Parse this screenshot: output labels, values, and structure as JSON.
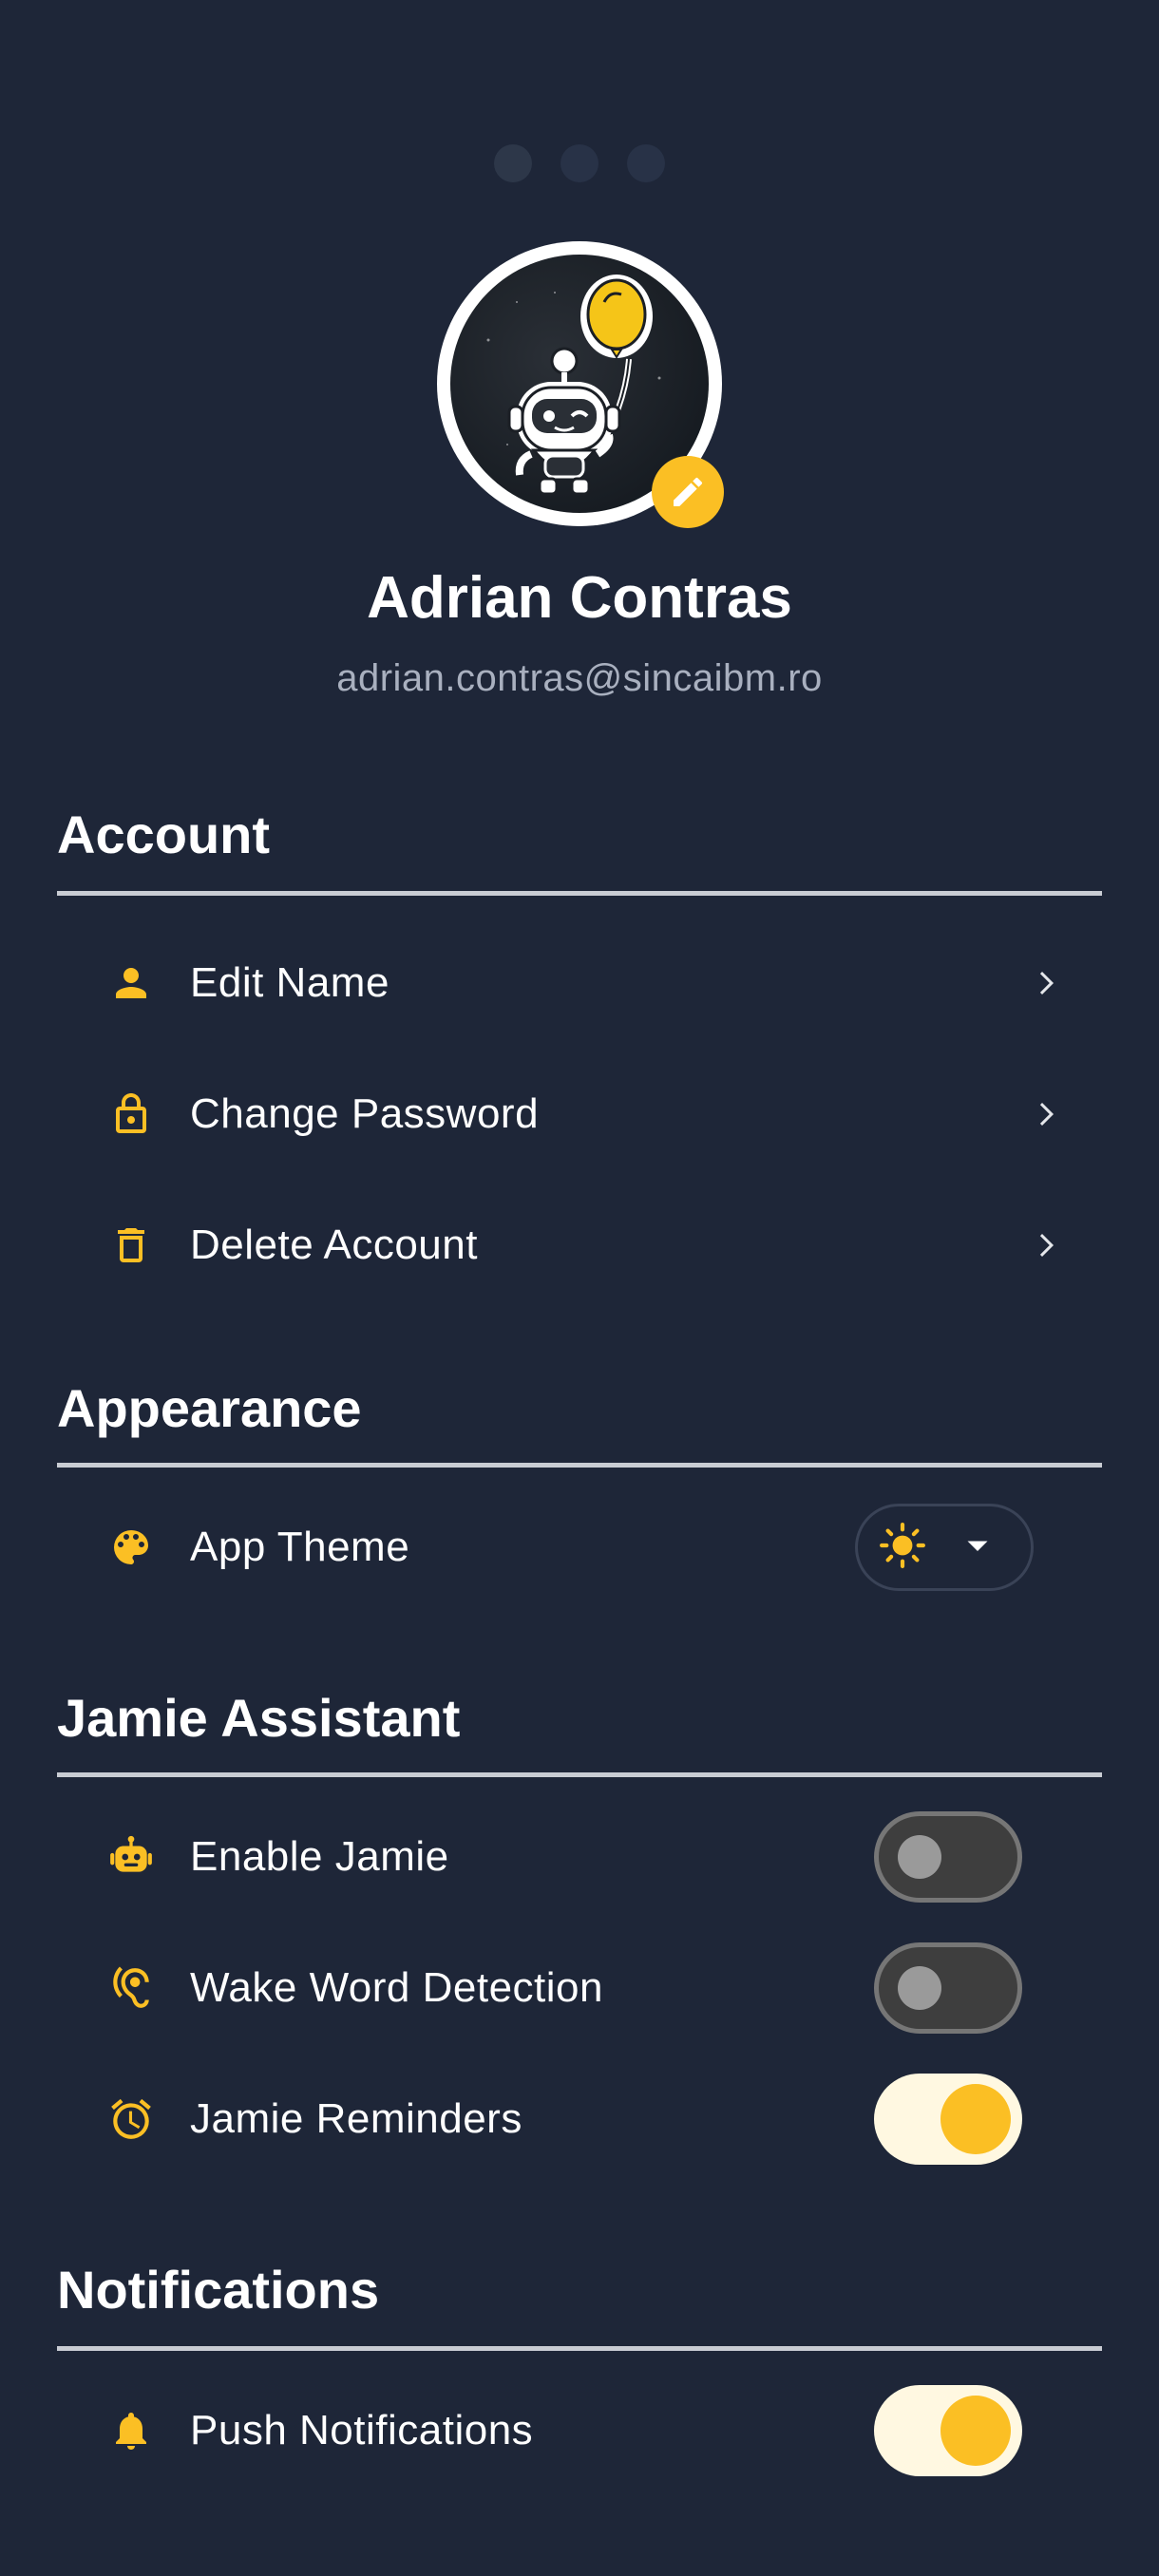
{
  "profile": {
    "name": "Adrian Contras",
    "email": "adrian.contras@sincaibm.ro"
  },
  "colors": {
    "background": "#1e2638",
    "accent": "#fbbf24",
    "text": "#ffffff",
    "muted": "#a9b0bf",
    "divider": "#c9ccd3"
  },
  "pager": {
    "count": 3,
    "active_index": 0
  },
  "sections": {
    "account": {
      "title": "Account",
      "items": [
        {
          "label": "Edit Name",
          "icon": "person-icon"
        },
        {
          "label": "Change Password",
          "icon": "lock-icon"
        },
        {
          "label": "Delete Account",
          "icon": "trash-icon"
        }
      ]
    },
    "appearance": {
      "title": "Appearance",
      "items": [
        {
          "label": "App Theme",
          "icon": "palette-icon",
          "selected_theme_icon": "sun-icon"
        }
      ]
    },
    "assistant": {
      "title": "Jamie Assistant",
      "items": [
        {
          "label": "Enable Jamie",
          "icon": "robot-icon",
          "enabled": false
        },
        {
          "label": "Wake Word Detection",
          "icon": "hearing-icon",
          "enabled": false
        },
        {
          "label": "Jamie Reminders",
          "icon": "alarm-icon",
          "enabled": true
        }
      ]
    },
    "notifications": {
      "title": "Notifications",
      "items": [
        {
          "label": "Push Notifications",
          "icon": "bell-icon",
          "enabled": true
        }
      ]
    }
  }
}
